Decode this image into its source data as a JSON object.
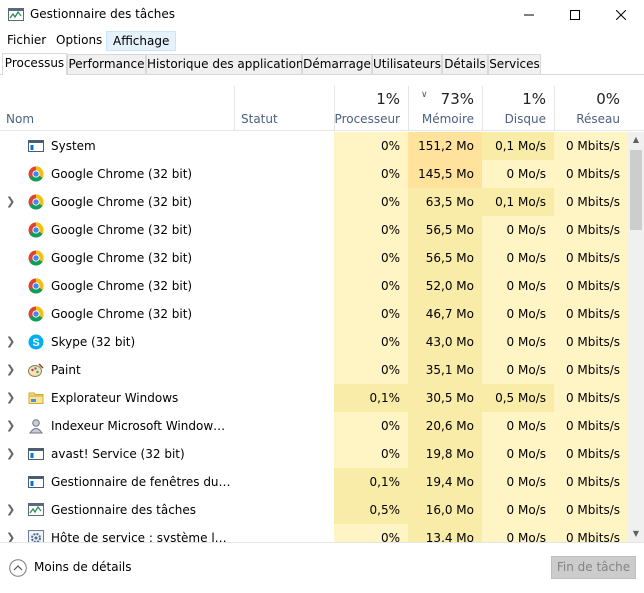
{
  "window": {
    "title": "Gestionnaire des tâches"
  },
  "menu": [
    {
      "label": "Fichier",
      "active": false
    },
    {
      "label": "Options",
      "active": false
    },
    {
      "label": "Affichage",
      "active": true
    }
  ],
  "tabs": [
    {
      "label": "Processus",
      "active": true
    },
    {
      "label": "Performance",
      "active": false
    },
    {
      "label": "Historique des applications",
      "active": false
    },
    {
      "label": "Démarrage",
      "active": false
    },
    {
      "label": "Utilisateurs",
      "active": false
    },
    {
      "label": "Détails",
      "active": false
    },
    {
      "label": "Services",
      "active": false
    }
  ],
  "columns": {
    "name": "Nom",
    "status": "Statut",
    "cpu": {
      "label": "Processeur",
      "percent": "1%"
    },
    "memory": {
      "label": "Mémoire",
      "percent": "73%"
    },
    "disk": {
      "label": "Disque",
      "percent": "1%"
    },
    "network": {
      "label": "Réseau",
      "percent": "0%"
    }
  },
  "processes": [
    {
      "name": "System",
      "icon": "system-window-icon",
      "expandable": false,
      "status": "",
      "cpu": "0%",
      "memory": "151,2 Mo",
      "disk": "0,1 Mo/s",
      "network": "0 Mbits/s"
    },
    {
      "name": "Google Chrome (32 bit)",
      "icon": "chrome-icon",
      "expandable": false,
      "status": "",
      "cpu": "0%",
      "memory": "145,5 Mo",
      "disk": "0 Mo/s",
      "network": "0 Mbits/s"
    },
    {
      "name": "Google Chrome (32 bit)",
      "icon": "chrome-icon",
      "expandable": true,
      "status": "",
      "cpu": "0%",
      "memory": "63,5 Mo",
      "disk": "0,1 Mo/s",
      "network": "0 Mbits/s"
    },
    {
      "name": "Google Chrome (32 bit)",
      "icon": "chrome-icon",
      "expandable": false,
      "status": "",
      "cpu": "0%",
      "memory": "56,5 Mo",
      "disk": "0 Mo/s",
      "network": "0 Mbits/s"
    },
    {
      "name": "Google Chrome (32 bit)",
      "icon": "chrome-icon",
      "expandable": false,
      "status": "",
      "cpu": "0%",
      "memory": "56,5 Mo",
      "disk": "0 Mo/s",
      "network": "0 Mbits/s"
    },
    {
      "name": "Google Chrome (32 bit)",
      "icon": "chrome-icon",
      "expandable": false,
      "status": "",
      "cpu": "0%",
      "memory": "52,0 Mo",
      "disk": "0 Mo/s",
      "network": "0 Mbits/s"
    },
    {
      "name": "Google Chrome (32 bit)",
      "icon": "chrome-icon",
      "expandable": false,
      "status": "",
      "cpu": "0%",
      "memory": "46,7 Mo",
      "disk": "0 Mo/s",
      "network": "0 Mbits/s"
    },
    {
      "name": "Skype (32 bit)",
      "icon": "skype-icon",
      "expandable": true,
      "status": "",
      "cpu": "0%",
      "memory": "43,0 Mo",
      "disk": "0 Mo/s",
      "network": "0 Mbits/s"
    },
    {
      "name": "Paint",
      "icon": "paint-icon",
      "expandable": true,
      "status": "",
      "cpu": "0%",
      "memory": "35,1 Mo",
      "disk": "0 Mo/s",
      "network": "0 Mbits/s"
    },
    {
      "name": "Explorateur Windows",
      "icon": "folder-icon",
      "expandable": true,
      "status": "",
      "cpu": "0,1%",
      "memory": "30,5 Mo",
      "disk": "0,5 Mo/s",
      "network": "0 Mbits/s"
    },
    {
      "name": "Indexeur Microsoft Windows Se...",
      "icon": "indexer-icon",
      "expandable": true,
      "status": "",
      "cpu": "0%",
      "memory": "20,6 Mo",
      "disk": "0 Mo/s",
      "network": "0 Mbits/s"
    },
    {
      "name": "avast! Service (32 bit)",
      "icon": "service-window-icon",
      "expandable": true,
      "status": "",
      "cpu": "0%",
      "memory": "19,8 Mo",
      "disk": "0 Mo/s",
      "network": "0 Mbits/s"
    },
    {
      "name": "Gestionnaire de fenêtres du Bur...",
      "icon": "service-window-icon",
      "expandable": false,
      "status": "",
      "cpu": "0,1%",
      "memory": "19,4 Mo",
      "disk": "0 Mo/s",
      "network": "0 Mbits/s"
    },
    {
      "name": "Gestionnaire des tâches",
      "icon": "task-manager-icon",
      "expandable": true,
      "status": "",
      "cpu": "0,5%",
      "memory": "16,0 Mo",
      "disk": "0 Mo/s",
      "network": "0 Mbits/s"
    },
    {
      "name": "Hôte de service : système local (...",
      "icon": "gear-window-icon",
      "expandable": true,
      "status": "",
      "cpu": "0%",
      "memory": "13,4 Mo",
      "disk": "0 Mo/s",
      "network": "0 Mbits/s"
    }
  ],
  "footer": {
    "less_details": "Moins de détails",
    "end_task": "Fin de tâche"
  },
  "colors": {
    "cell_light": "#fff4c4",
    "cell_medium": "#f9eca8",
    "cell_strong": "#ffe29c",
    "accent_blue": "#0078d7",
    "chrome_red": "#db4437",
    "chrome_yellow": "#f4c20d",
    "chrome_green": "#0f9d58",
    "skype_blue": "#00aff0"
  }
}
